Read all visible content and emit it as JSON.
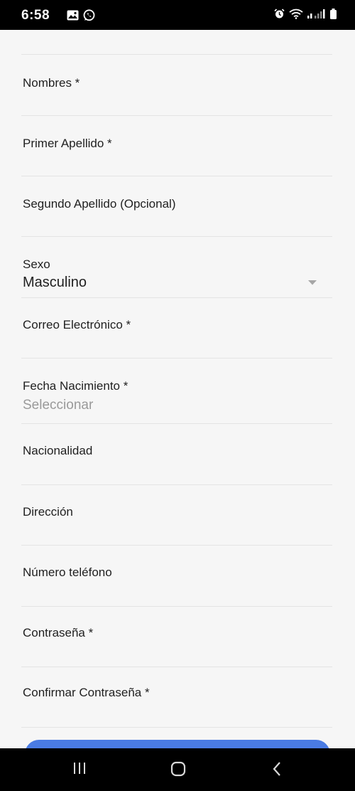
{
  "status_bar": {
    "time": "6:58",
    "icons_left": [
      "gallery-icon",
      "whatsapp-icon"
    ],
    "icons_right": [
      "alarm-icon",
      "wifi-icon",
      "signal-icon",
      "battery-icon"
    ]
  },
  "form": {
    "fields": [
      {
        "label": "Nombres *"
      },
      {
        "label": "Primer Apellido *"
      },
      {
        "label": "Segundo Apellido (Opcional)"
      },
      {
        "label": "Sexo",
        "value": "Masculino"
      },
      {
        "label": "Correo Electrónico *"
      },
      {
        "label": "Fecha Nacimiento *",
        "placeholder": "Seleccionar"
      },
      {
        "label": "Nacionalidad"
      },
      {
        "label": "Dirección"
      },
      {
        "label": "Número teléfono"
      },
      {
        "label": "Contraseña *"
      },
      {
        "label": "Confirmar Contraseña *"
      }
    ]
  },
  "colors": {
    "accent": "#4a7be3",
    "background": "#f6f6f6",
    "divider": "#e4e4e4",
    "placeholder": "#9a9a9a"
  },
  "nav_bar": {
    "buttons": [
      "recent-apps-icon",
      "home-icon",
      "back-icon"
    ]
  }
}
